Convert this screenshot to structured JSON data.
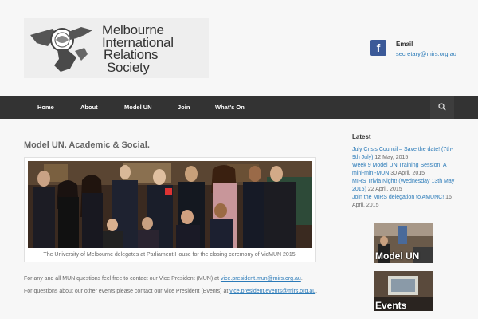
{
  "header": {
    "logo_lines": [
      "Melbourne",
      "International",
      "Relations",
      "Society"
    ],
    "facebook_glyph": "f",
    "email_label": "Email",
    "email_address": "secretary@mirs.org.au"
  },
  "nav": {
    "items": [
      {
        "label": "Home"
      },
      {
        "label": "About"
      },
      {
        "label": "Model UN"
      },
      {
        "label": "Join"
      },
      {
        "label": "What's On"
      }
    ],
    "search_icon": "search-icon"
  },
  "main": {
    "title": "Model UN. Academic & Social.",
    "caption": "The University of Melbourne delegates at Parliament House for the closing ceremony of VicMUN 2015.",
    "para1_text": "For any and all MUN questions feel free to contact our Vice President (MUN) at ",
    "para1_link": "vice.president.mun@mirs.org.au",
    "para1_end": ".",
    "para2_text": "For  questions about our other events please contact our Vice President (Events) at ",
    "para2_link": "vice.president.events@mirs.org.au",
    "para2_end": "."
  },
  "sidebar": {
    "title": "Latest",
    "posts": [
      {
        "title": "July Crisis Council – Save the date! (7th-9th July)",
        "date": " 12 May, 2015"
      },
      {
        "title": "Week 9 Model UN Training Session: A mini-mini-MUN",
        "date": " 30 April, 2015"
      },
      {
        "title": "MIRS Trivia Night! (Wednesday 13th May 2015)",
        "date": " 22 April, 2015"
      },
      {
        "title": "Join the MIRS delegation to AMUNC!",
        "date": " 16 April, 2015"
      }
    ],
    "widget1_label": "Model UN",
    "widget2_label": "Events"
  },
  "colors": {
    "nav_bg": "#333333",
    "link": "#2a7ab8",
    "facebook": "#3b5998"
  }
}
